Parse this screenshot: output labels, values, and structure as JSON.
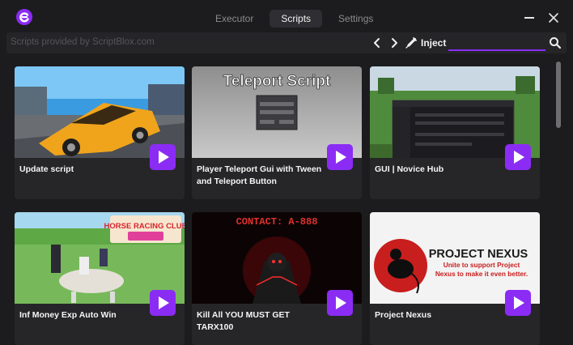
{
  "header": {
    "tabs": [
      {
        "label": "Executor",
        "active": false
      },
      {
        "label": "Scripts",
        "active": true
      },
      {
        "label": "Settings",
        "active": false
      }
    ]
  },
  "toolbar": {
    "provider_text": "Scripts provided by ScriptBlox.com",
    "inject_label": "Inject",
    "search_value": ""
  },
  "cards": [
    {
      "title": "Update script"
    },
    {
      "title": "Player Teleport Gui with Tween and Teleport Button",
      "thumb_text": "Teleport Script"
    },
    {
      "title": "GUI | Novice Hub"
    },
    {
      "title": "Inf Money Exp Auto Win",
      "thumb_text": "HORSE RACING CLUB"
    },
    {
      "title": "Kill All YOU MUST GET TARX100",
      "thumb_text": "CONTACT: A-888"
    },
    {
      "title": "Project Nexus",
      "thumb_text": "PROJECT NEXUS",
      "thumb_subtext": "Unite to support Project Nexus to make it even better."
    }
  ],
  "colors": {
    "accent": "#8b2cf5",
    "background": "#1c1c1e",
    "card": "#262628"
  }
}
